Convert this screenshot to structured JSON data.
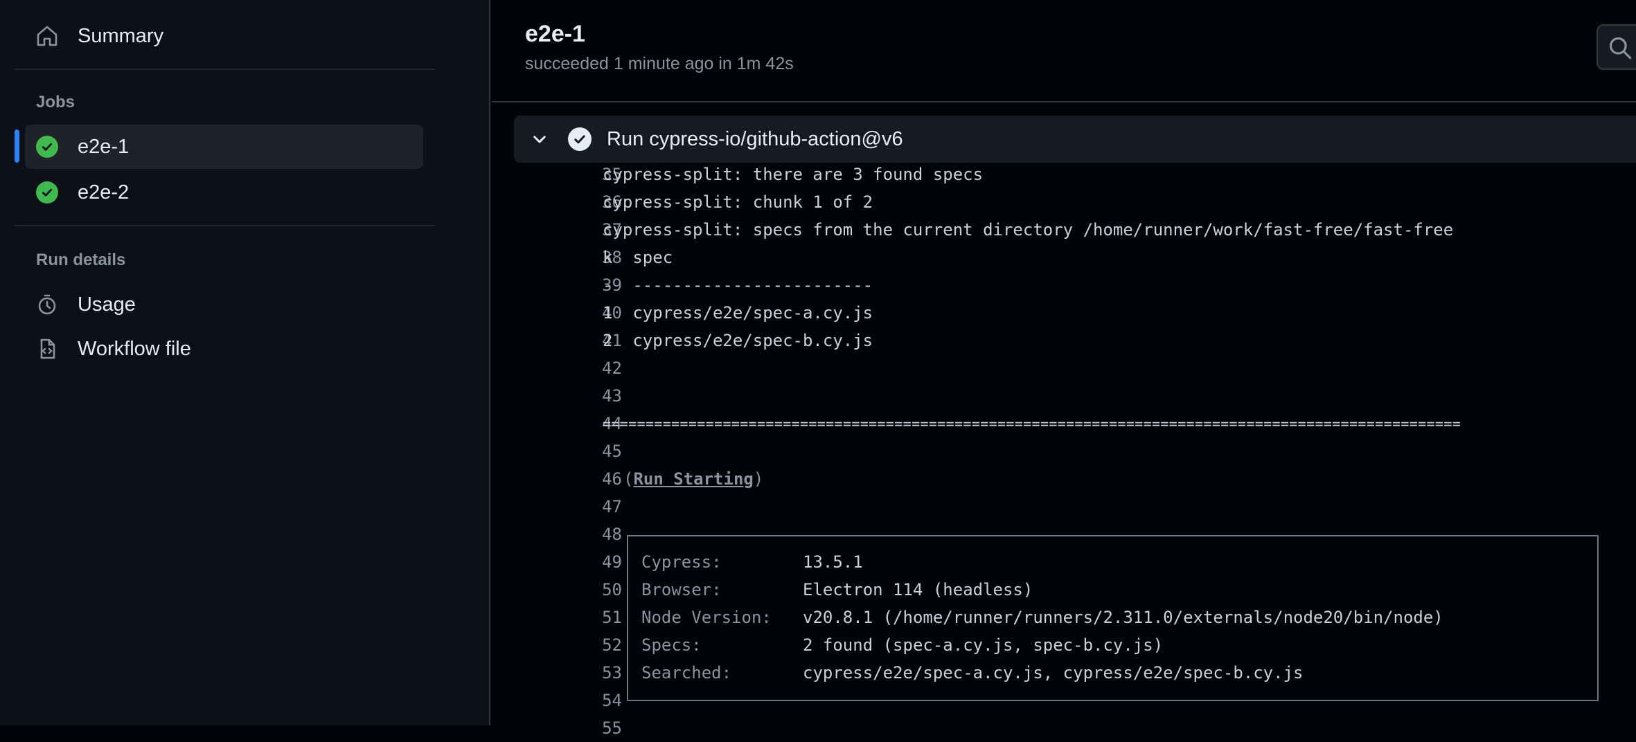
{
  "sidebar": {
    "summary_label": "Summary",
    "jobs_heading": "Jobs",
    "jobs": [
      {
        "label": "e2e-1",
        "status": "success",
        "active": true
      },
      {
        "label": "e2e-2",
        "status": "success",
        "active": false
      }
    ],
    "run_details_heading": "Run details",
    "usage_label": "Usage",
    "workflow_label": "Workflow file"
  },
  "header": {
    "title": "e2e-1",
    "subtitle": "succeeded 1 minute ago in 1m 42s"
  },
  "step": {
    "name": "Run cypress-io/github-action@v6"
  },
  "log": {
    "lines": [
      {
        "n": "35",
        "t": "cypress-split: there are 3 found specs"
      },
      {
        "n": "36",
        "t": "cypress-split: chunk 1 of 2"
      },
      {
        "n": "37",
        "t": "cypress-split: specs from the current directory /home/runner/work/fast-free/fast-free"
      },
      {
        "n": "38",
        "t": "k  spec"
      },
      {
        "n": "39",
        "t": "-  ------------------------"
      },
      {
        "n": "40",
        "t": "1  cypress/e2e/spec-a.cy.js"
      },
      {
        "n": "41",
        "t": "2  cypress/e2e/spec-b.cy.js"
      },
      {
        "n": "42",
        "t": ""
      },
      {
        "n": "43",
        "t": ""
      },
      {
        "n": "44",
        "t": "===================================================================================================="
      },
      {
        "n": "45",
        "t": ""
      },
      {
        "n": "46",
        "t": ""
      },
      {
        "n": "47",
        "t": ""
      },
      {
        "n": "48",
        "t": ""
      },
      {
        "n": "49",
        "t": ""
      },
      {
        "n": "50",
        "t": ""
      },
      {
        "n": "51",
        "t": ""
      },
      {
        "n": "52",
        "t": ""
      },
      {
        "n": "53",
        "t": ""
      },
      {
        "n": "54",
        "t": ""
      },
      {
        "n": "55",
        "t": ""
      }
    ],
    "run_starting": {
      "open": "(",
      "label": "Run Starting",
      "close": ")"
    },
    "info": [
      {
        "k": "Cypress:",
        "v": "13.5.1"
      },
      {
        "k": "Browser:",
        "v": "Electron 114 (headless)"
      },
      {
        "k": "Node Version:",
        "v": "v20.8.1 (/home/runner/runners/2.311.0/externals/node20/bin/node)"
      },
      {
        "k": "Specs:",
        "v": "2 found (spec-a.cy.js, spec-b.cy.js)"
      },
      {
        "k": "Searched:",
        "v": "cypress/e2e/spec-a.cy.js, cypress/e2e/spec-b.cy.js"
      }
    ]
  },
  "colors": {
    "success": "#3fb950",
    "accent": "#2f81f7",
    "bg": "#010409",
    "sidebar_bg": "#0d1117"
  }
}
